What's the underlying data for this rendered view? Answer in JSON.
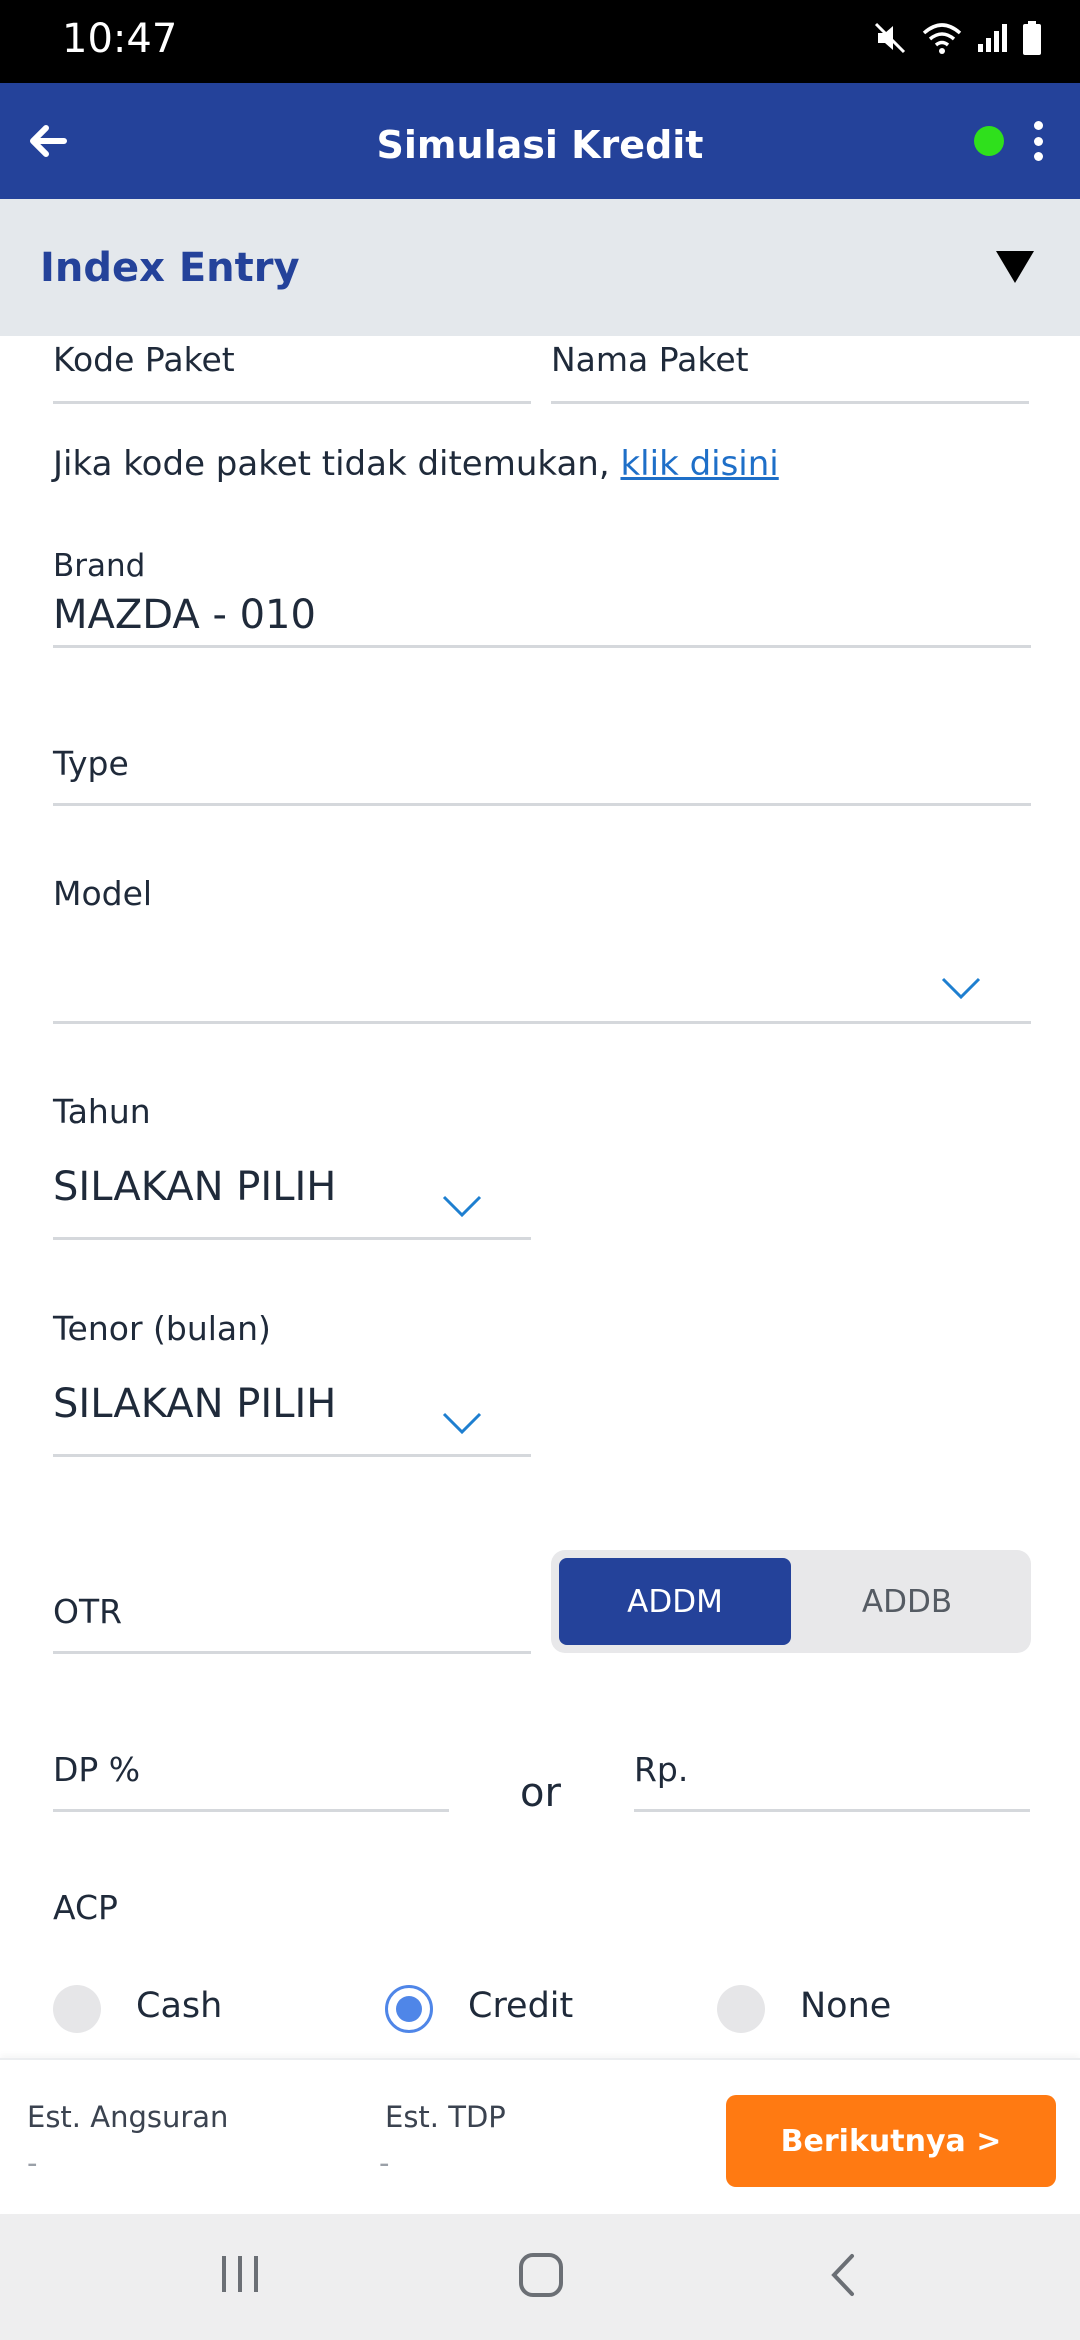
{
  "status_bar": {
    "time": "10:47",
    "icons": [
      "mute-icon",
      "wifi-icon",
      "signal-icon",
      "battery-icon"
    ]
  },
  "app_bar": {
    "title": "Simulasi Kredit",
    "status_color": "#2fe01c",
    "brand_color": "#24429a"
  },
  "section": {
    "title": "Index Entry"
  },
  "form": {
    "kode_paket_label": "Kode Paket",
    "nama_paket_label": "Nama Paket",
    "hint_text": "Jika kode paket tidak ditemukan, ",
    "hint_link": "klik disini",
    "brand_label": "Brand",
    "brand_value": "MAZDA - 010",
    "type_label": "Type",
    "model_label": "Model",
    "tahun_label": "Tahun",
    "tahun_value": "SILAKAN PILIH",
    "tenor_label": "Tenor (bulan)",
    "tenor_value": "SILAKAN PILIH",
    "otr_label": "OTR",
    "segment": {
      "options": [
        "ADDM",
        "ADDB"
      ],
      "selected": "ADDM"
    },
    "dp_label": "DP %",
    "or_text": "or",
    "rp_label": "Rp.",
    "acp_label": "ACP",
    "acp_options": [
      "Cash",
      "Credit",
      "None"
    ],
    "acp_selected": "Credit"
  },
  "summary": {
    "angsuran_label": "Est. Angsuran",
    "angsuran_value": "-",
    "tdp_label": "Est. TDP",
    "tdp_value": "-",
    "next_label": "Berikutnya >",
    "next_color": "#ff7a12"
  }
}
